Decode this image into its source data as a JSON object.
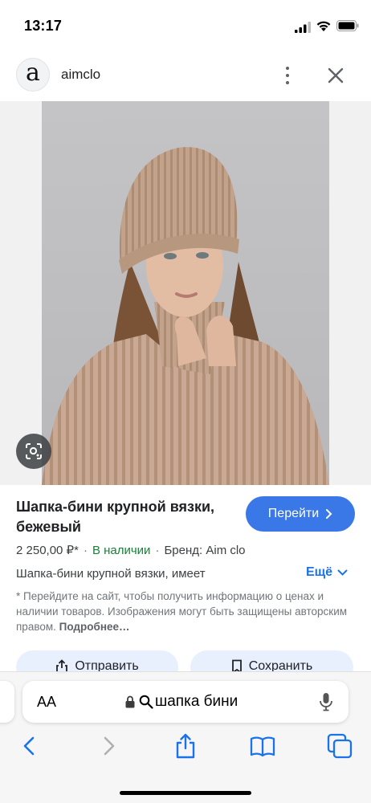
{
  "status_bar": {
    "time": "13:17"
  },
  "site": {
    "logo_letter": "a",
    "name": "aimclo"
  },
  "product": {
    "title": "Шапка-бини крупной вязки, бежевый",
    "go_label": "Перейти",
    "price": "2 250,00 ₽*",
    "availability": "В наличии",
    "brand": "Бренд: Aim clo",
    "separator": "·",
    "description": "Шапка-бини крупной вязки, имеет",
    "more_label": "Ещё",
    "note_text": "* Перейдите на сайт, чтобы получить информацию о ценах и наличии товаров. Изображения могут быть защищены авторским правом.",
    "note_link": "Подробнее…"
  },
  "actions": {
    "share_label": "Отправить",
    "save_label": "Сохранить"
  },
  "browser": {
    "text_size_label": "AA",
    "query": "шапка бини"
  },
  "colors": {
    "accent": "#3b78e7",
    "in_stock": "#188038",
    "link": "#1a73e8",
    "chip_bg": "#e8f0fe"
  },
  "icons": [
    "signal-icon",
    "wifi-icon",
    "battery-icon",
    "more-vert-icon",
    "close-icon",
    "lens-icon",
    "chevron-right-icon",
    "chevron-down-icon",
    "share-icon",
    "bookmark-icon",
    "lock-icon",
    "search-icon",
    "mic-icon",
    "back-icon",
    "forward-icon",
    "bookmarks-icon",
    "tabs-icon"
  ]
}
